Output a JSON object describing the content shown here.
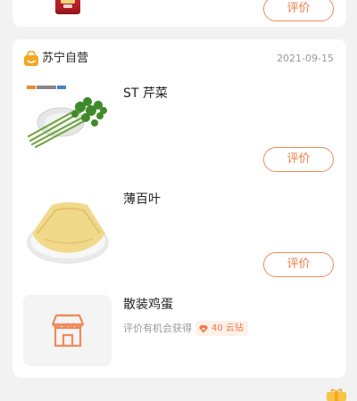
{
  "previous_order": {
    "review_label": "评价"
  },
  "order": {
    "store_name": "苏宁自营",
    "date": "2021-09-15",
    "items": [
      {
        "name": "ST 芹菜",
        "review_label": "评价",
        "image_icon": "celery"
      },
      {
        "name": "薄百叶",
        "review_label": "评价",
        "image_icon": "tofu-skin"
      },
      {
        "name": "散装鸡蛋",
        "hint": "评价有机会获得",
        "reward": "40 云钻",
        "image_icon": "store-placeholder"
      }
    ]
  },
  "colors": {
    "accent": "#f07a45",
    "accent_border": "#f08a5a",
    "store_icon": "#f5a623",
    "background": "#f2f2f2",
    "card": "#ffffff"
  }
}
